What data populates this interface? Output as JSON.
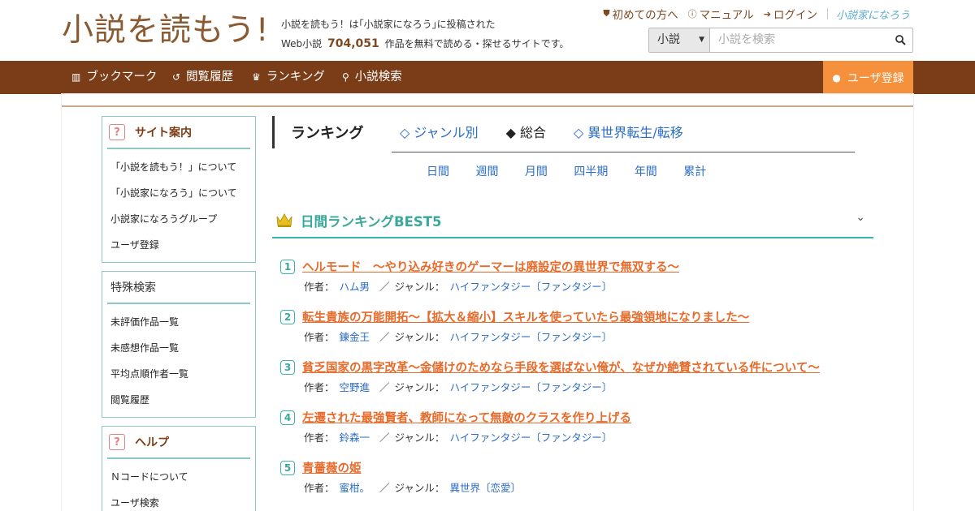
{
  "header": {
    "logo": "小説を読もう!",
    "tagline_line1": "小説を読もう！は｢小説家になろう｣に投稿された",
    "tagline_prefix": "Web小説",
    "tagline_count": "704,051",
    "tagline_suffix": "作品を無料で読める・探せるサイトです。",
    "links": [
      {
        "label": "初めての方へ",
        "icon": "shield-icon"
      },
      {
        "label": "マニュアル",
        "icon": "question-circle-icon"
      },
      {
        "label": "ログイン",
        "icon": "login-icon"
      }
    ],
    "partner_logo": "小説家になろう",
    "search": {
      "select_value": "小説",
      "placeholder": "小説を検索"
    }
  },
  "nav": {
    "items": [
      {
        "label": "ブックマーク",
        "icon": "bookmark-icon"
      },
      {
        "label": "閲覧履歴",
        "icon": "history-icon"
      },
      {
        "label": "ランキング",
        "icon": "crown-icon"
      },
      {
        "label": "小説検索",
        "icon": "search-icon"
      }
    ],
    "register": "ユーザ登録"
  },
  "sidebar": {
    "site_guide": {
      "title": "サイト案内",
      "items": [
        "「小説を読もう！」について",
        "「小説家になろう」について",
        "小説家になろうグループ",
        "ユーザ登録"
      ]
    },
    "special_search": {
      "title": "特殊検索",
      "items": [
        "未評価作品一覧",
        "未感想作品一覧",
        "平均点順作者一覧",
        "閲覧履歴"
      ]
    },
    "help": {
      "title": "ヘルプ",
      "items": [
        "Ｎコードについて",
        "ユーザ検索"
      ]
    }
  },
  "ranking": {
    "heading": "ランキング",
    "tabs": [
      {
        "label": "◇ ジャンル別",
        "active": false
      },
      {
        "label": "◆ 総合",
        "active": true
      },
      {
        "label": "◇ 異世界転生/転移",
        "active": false
      }
    ],
    "periods": [
      "日間",
      "週間",
      "月間",
      "四半期",
      "年間",
      "累計"
    ],
    "best_title": "日間ランキングBEST5",
    "author_label": "作者：",
    "genre_label": "ジャンル：",
    "entries": [
      {
        "rank": "1",
        "title": "ヘルモード　～やり込み好きのゲーマーは廃設定の異世界で無双する～",
        "author": "ハム男",
        "genre": "ハイファンタジー〔ファンタジー〕"
      },
      {
        "rank": "2",
        "title": "転生貴族の万能開拓～【拡大＆縮小】スキルを使っていたら最強領地になりました～",
        "author": "錬金王",
        "genre": "ハイファンタジー〔ファンタジー〕"
      },
      {
        "rank": "3",
        "title": "貧乏国家の黒字改革〜金儲けのためなら手段を選ばない俺が、なぜか絶賛されている件について〜",
        "author": "空野進",
        "genre": "ハイファンタジー〔ファンタジー〕"
      },
      {
        "rank": "4",
        "title": "左遷された最強賢者、教師になって無敵のクラスを作り上げる",
        "author": "鈴森一",
        "genre": "ハイファンタジー〔ファンタジー〕"
      },
      {
        "rank": "5",
        "title": "青薔薇の姫",
        "author": "蜜柑。",
        "genre": "異世界〔恋愛〕"
      }
    ]
  }
}
